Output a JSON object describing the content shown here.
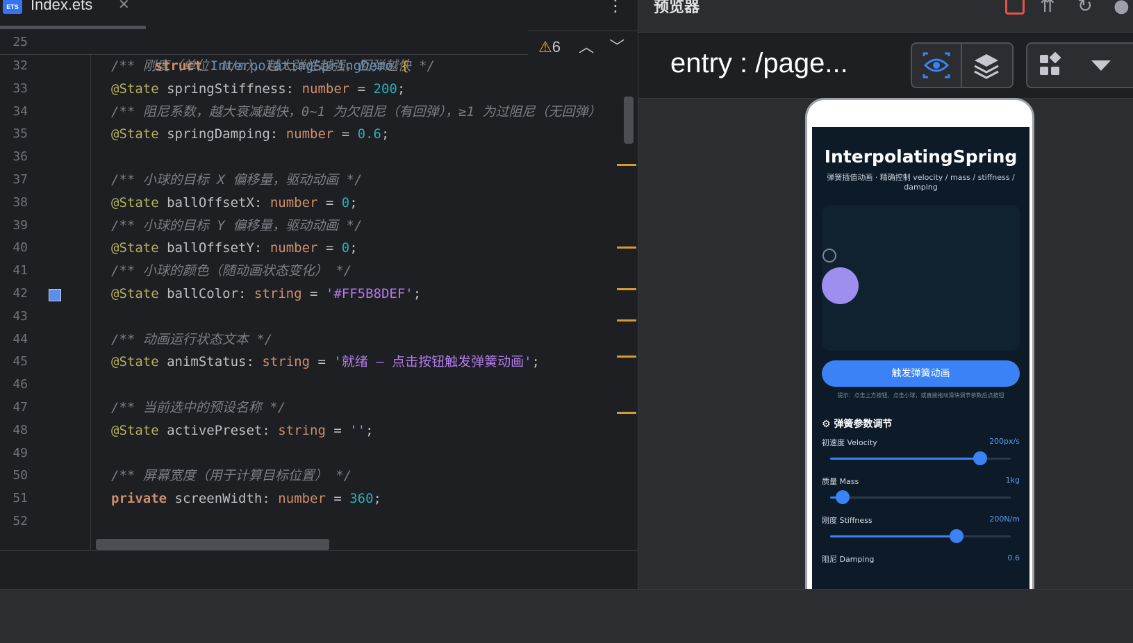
{
  "editor": {
    "tab": {
      "icon_text": "ETS",
      "file_name": "Index.ets",
      "close": "✕",
      "more": "⋮"
    },
    "sticky": {
      "line": "25",
      "kw": "struct",
      "name": "InterpolatingSpringDemo",
      "brace": "{"
    },
    "inspections": {
      "warning_count": "6",
      "up": "︿",
      "down": "﹀"
    },
    "lines": [
      {
        "n": "32",
        "comment": "/** 刚度（单位：N/m），越大弹性越强，回弹越快 */"
      },
      {
        "n": "33",
        "dec": "@State",
        "name": " springStiffness",
        "colon": ": ",
        "type": "number",
        "eq": " = ",
        "value": "200",
        "end": ";"
      },
      {
        "n": "34",
        "comment": "/** 阻尼系数，越大衰减越快，0~1 为欠阻尼（有回弹），≥1 为过阻尼（无回弹）"
      },
      {
        "n": "35",
        "dec": "@State",
        "name": " springDamping",
        "colon": ": ",
        "type": "number",
        "eq": " = ",
        "value": "0.6",
        "end": ";"
      },
      {
        "n": "36"
      },
      {
        "n": "37",
        "comment": "/** 小球的目标 X 偏移量，驱动动画 */"
      },
      {
        "n": "38",
        "dec": "@State",
        "name": " ballOffsetX",
        "colon": ": ",
        "type": "number",
        "eq": " = ",
        "value": "0",
        "end": ";"
      },
      {
        "n": "39",
        "comment": "/** 小球的目标 Y 偏移量，驱动动画 */"
      },
      {
        "n": "40",
        "dec": "@State",
        "name": " ballOffsetY",
        "colon": ": ",
        "type": "number",
        "eq": " = ",
        "value": "0",
        "end": ";"
      },
      {
        "n": "41",
        "comment": "/** 小球的颜色（随动画状态变化） */"
      },
      {
        "n": "42",
        "dec": "@State",
        "name": " ballColor",
        "colon": ": ",
        "type": "string",
        "eq": " = ",
        "str": "'#FF5B8DEF'",
        "end": ";"
      },
      {
        "n": "43"
      },
      {
        "n": "44",
        "comment": "/** 动画运行状态文本 */"
      },
      {
        "n": "45",
        "dec": "@State",
        "name": " animStatus",
        "colon": ": ",
        "type": "string",
        "eq": " = ",
        "str": "'就绪 — 点击按钮触发弹簧动画'",
        "end": ";"
      },
      {
        "n": "46"
      },
      {
        "n": "47",
        "comment": "/** 当前选中的预设名称 */"
      },
      {
        "n": "48",
        "dec": "@State",
        "name": " activePreset",
        "colon": ": ",
        "type": "string",
        "eq": " = ",
        "str": "''",
        "end": ";"
      },
      {
        "n": "49"
      },
      {
        "n": "50",
        "comment": "/** 屏幕宽度（用于计算目标位置） */"
      },
      {
        "n": "51",
        "kw": "private",
        "name": " screenWidth",
        "colon": ": ",
        "type": "number",
        "eq": " = ",
        "value": "360",
        "end": ";"
      },
      {
        "n": "52"
      }
    ],
    "swatch_color": "#5B8DEF"
  },
  "preview": {
    "title": "预览器",
    "path": "entry : /page...",
    "icons": [
      "stop-icon",
      "pin-icon",
      "refresh-icon",
      "location-icon",
      "eye-icon",
      "layers-icon",
      "grid-icon",
      "dropdown-icon"
    ],
    "app": {
      "title": "InterpolatingSpring",
      "subtitle": "弹簧插值动画 · 精确控制 velocity / mass / stiffness / damping",
      "button": "触发弹簧动画",
      "hint": "提示：点击上方按钮、点击小球，或直接拖动滑块调节参数后点按钮",
      "params_header": "弹簧参数调节",
      "params": [
        {
          "label": "初速度 Velocity",
          "value": "200px/s",
          "fraction": 0.83
        },
        {
          "label": "质量 Mass",
          "value": "1kg",
          "fraction": 0.07
        },
        {
          "label": "刚度 Stiffness",
          "value": "200N/m",
          "fraction": 0.7
        },
        {
          "label": "阻尼 Damping",
          "value": "0.6"
        }
      ],
      "ball_color": "#9D8EF0",
      "accent": "#3A82F6"
    }
  }
}
